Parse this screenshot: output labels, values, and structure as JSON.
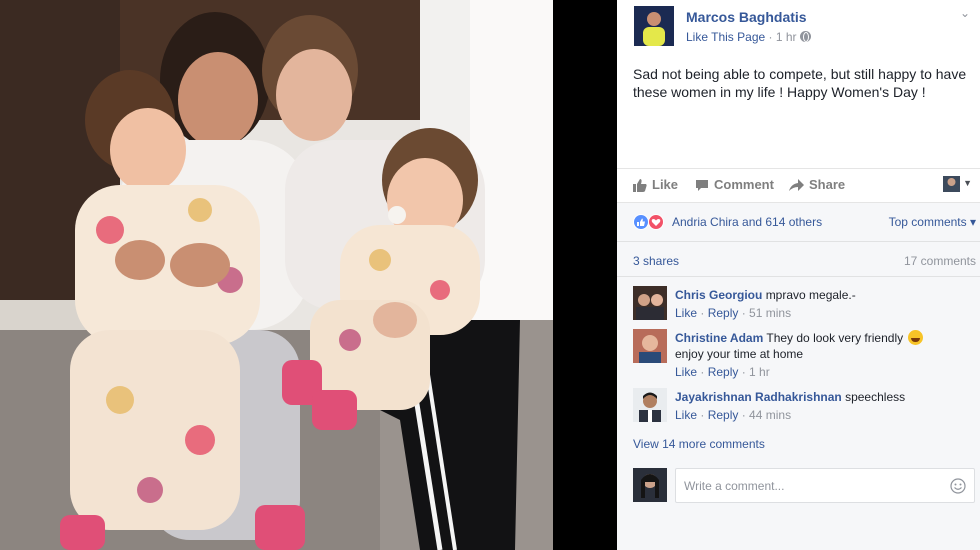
{
  "post": {
    "page_name": "Marcos Baghdatis",
    "like_page": "Like This Page",
    "separator": " · ",
    "time": "1 hr",
    "text": "Sad not being able to compete, but still happy to have these women in my life ! Happy Women's Day !"
  },
  "actions": {
    "like": "Like",
    "comment": "Comment",
    "share": "Share"
  },
  "reactions": {
    "icons": [
      "like-icon",
      "love-icon"
    ],
    "text": "Andria Chira and 614 others",
    "sort_label": "Top comments ▾"
  },
  "stats": {
    "shares": "3 shares",
    "comments_count": "17 comments"
  },
  "comments": [
    {
      "author": "Chris Georgiou",
      "text": "mpravo megale.-",
      "like": "Like",
      "reply": "Reply",
      "time": "51 mins"
    },
    {
      "author": "Christine Adam",
      "text": "They do look very friendly",
      "text_line2": "enjoy your time at home",
      "like": "Like",
      "reply": "Reply",
      "time": "1 hr"
    },
    {
      "author": "Jayakrishnan Radhakrishnan",
      "text": "speechless",
      "like": "Like",
      "reply": "Reply",
      "time": "44 mins"
    }
  ],
  "view_more": "View 14 more comments",
  "compose": {
    "placeholder": "Write a comment..."
  },
  "colors": {
    "link": "#365899",
    "meta": "#90949c",
    "like_blue": "#5890ff",
    "love_red": "#f25268"
  }
}
